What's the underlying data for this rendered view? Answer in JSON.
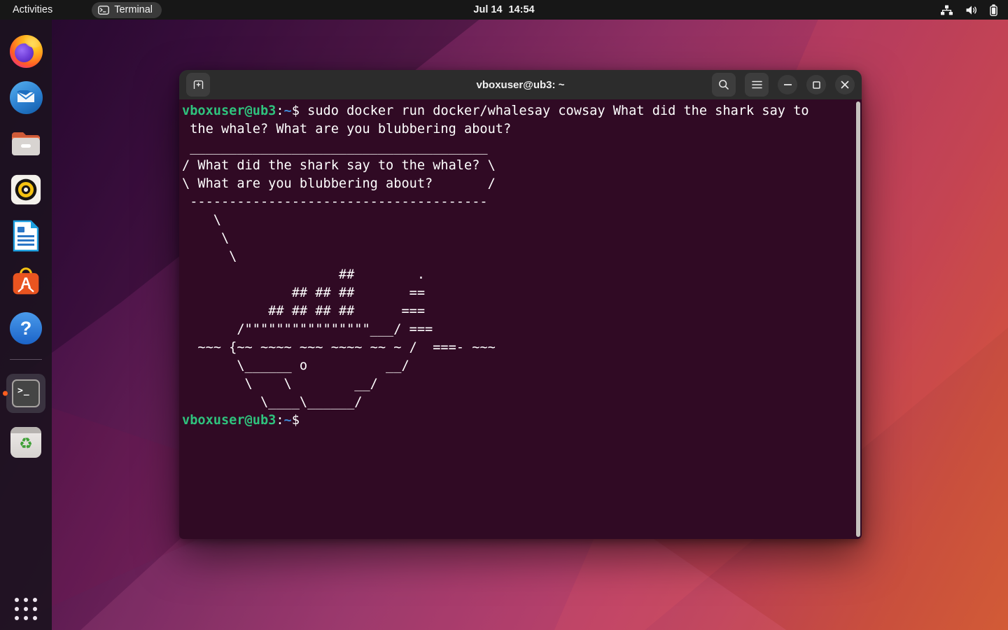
{
  "top_bar": {
    "activities_label": "Activities",
    "focused_app": "Terminal",
    "clock_date": "Jul 14",
    "clock_time": "14:54",
    "tray_icons": [
      "network-icon",
      "volume-icon",
      "battery-icon"
    ]
  },
  "dock": {
    "items": [
      "firefox",
      "thunderbird",
      "files",
      "rhythmbox",
      "libreoffice-writer",
      "ubuntu-software",
      "help",
      "terminal",
      "trash"
    ],
    "active_item": "terminal",
    "terminal_glyph": ">_",
    "help_glyph": "?",
    "software_glyph": "A",
    "recycle_glyph": "♻"
  },
  "window": {
    "title": "vboxuser@ub3: ~",
    "header_icons": [
      "new-tab-icon",
      "search-icon",
      "menu-icon",
      "minimize-icon",
      "maximize-icon",
      "close-icon"
    ]
  },
  "terminal": {
    "prompt_user": "vboxuser@ub3",
    "prompt_colon": ":",
    "prompt_path": "~",
    "command_line1": "$ sudo docker run docker/whalesay cowsay What did the shark say to",
    "command_line2": " the whale? What are you blubbering about?",
    "cowsay_output": " ______________________________________\n/ What did the shark say to the whale? \\\n\\ What are you blubbering about?       /\n --------------------------------------\n    \\\n     \\\n      \\\n                    ##        .\n              ## ## ##       ==\n           ## ## ## ##      ===\n       /\"\"\"\"\"\"\"\"\"\"\"\"\"\"\"\"___/ ===\n  ~~~ {~~ ~~~~ ~~~ ~~~~ ~~ ~ /  ===- ~~~\n       \\______ o          __/\n        \\    \\        __/\n          \\____\\______/",
    "prompt_symbol_end": "$ "
  },
  "colors": {
    "accent_orange": "#e95420",
    "terminal_bg": "#300a24",
    "prompt_green": "#2fc27d",
    "prompt_blue": "#3f87d4"
  }
}
